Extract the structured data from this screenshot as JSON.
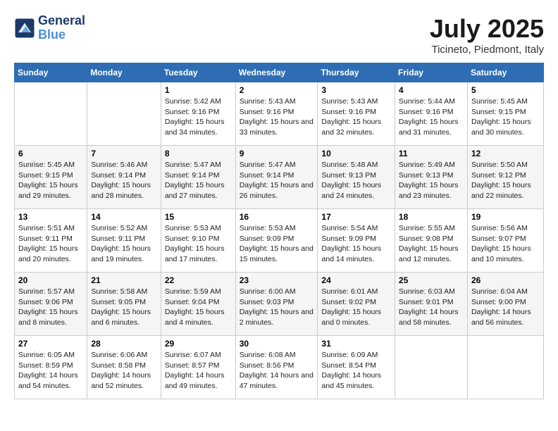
{
  "header": {
    "logo_line1": "General",
    "logo_line2": "Blue",
    "month": "July 2025",
    "location": "Ticineto, Piedmont, Italy"
  },
  "days_of_week": [
    "Sunday",
    "Monday",
    "Tuesday",
    "Wednesday",
    "Thursday",
    "Friday",
    "Saturday"
  ],
  "weeks": [
    [
      {
        "day": "",
        "info": ""
      },
      {
        "day": "",
        "info": ""
      },
      {
        "day": "1",
        "sunrise": "5:42 AM",
        "sunset": "9:16 PM",
        "daylight": "15 hours and 34 minutes."
      },
      {
        "day": "2",
        "sunrise": "5:43 AM",
        "sunset": "9:16 PM",
        "daylight": "15 hours and 33 minutes."
      },
      {
        "day": "3",
        "sunrise": "5:43 AM",
        "sunset": "9:16 PM",
        "daylight": "15 hours and 32 minutes."
      },
      {
        "day": "4",
        "sunrise": "5:44 AM",
        "sunset": "9:16 PM",
        "daylight": "15 hours and 31 minutes."
      },
      {
        "day": "5",
        "sunrise": "5:45 AM",
        "sunset": "9:15 PM",
        "daylight": "15 hours and 30 minutes."
      }
    ],
    [
      {
        "day": "6",
        "sunrise": "5:45 AM",
        "sunset": "9:15 PM",
        "daylight": "15 hours and 29 minutes."
      },
      {
        "day": "7",
        "sunrise": "5:46 AM",
        "sunset": "9:14 PM",
        "daylight": "15 hours and 28 minutes."
      },
      {
        "day": "8",
        "sunrise": "5:47 AM",
        "sunset": "9:14 PM",
        "daylight": "15 hours and 27 minutes."
      },
      {
        "day": "9",
        "sunrise": "5:47 AM",
        "sunset": "9:14 PM",
        "daylight": "15 hours and 26 minutes."
      },
      {
        "day": "10",
        "sunrise": "5:48 AM",
        "sunset": "9:13 PM",
        "daylight": "15 hours and 24 minutes."
      },
      {
        "day": "11",
        "sunrise": "5:49 AM",
        "sunset": "9:13 PM",
        "daylight": "15 hours and 23 minutes."
      },
      {
        "day": "12",
        "sunrise": "5:50 AM",
        "sunset": "9:12 PM",
        "daylight": "15 hours and 22 minutes."
      }
    ],
    [
      {
        "day": "13",
        "sunrise": "5:51 AM",
        "sunset": "9:11 PM",
        "daylight": "15 hours and 20 minutes."
      },
      {
        "day": "14",
        "sunrise": "5:52 AM",
        "sunset": "9:11 PM",
        "daylight": "15 hours and 19 minutes."
      },
      {
        "day": "15",
        "sunrise": "5:53 AM",
        "sunset": "9:10 PM",
        "daylight": "15 hours and 17 minutes."
      },
      {
        "day": "16",
        "sunrise": "5:53 AM",
        "sunset": "9:09 PM",
        "daylight": "15 hours and 15 minutes."
      },
      {
        "day": "17",
        "sunrise": "5:54 AM",
        "sunset": "9:09 PM",
        "daylight": "15 hours and 14 minutes."
      },
      {
        "day": "18",
        "sunrise": "5:55 AM",
        "sunset": "9:08 PM",
        "daylight": "15 hours and 12 minutes."
      },
      {
        "day": "19",
        "sunrise": "5:56 AM",
        "sunset": "9:07 PM",
        "daylight": "15 hours and 10 minutes."
      }
    ],
    [
      {
        "day": "20",
        "sunrise": "5:57 AM",
        "sunset": "9:06 PM",
        "daylight": "15 hours and 8 minutes."
      },
      {
        "day": "21",
        "sunrise": "5:58 AM",
        "sunset": "9:05 PM",
        "daylight": "15 hours and 6 minutes."
      },
      {
        "day": "22",
        "sunrise": "5:59 AM",
        "sunset": "9:04 PM",
        "daylight": "15 hours and 4 minutes."
      },
      {
        "day": "23",
        "sunrise": "6:00 AM",
        "sunset": "9:03 PM",
        "daylight": "15 hours and 2 minutes."
      },
      {
        "day": "24",
        "sunrise": "6:01 AM",
        "sunset": "9:02 PM",
        "daylight": "15 hours and 0 minutes."
      },
      {
        "day": "25",
        "sunrise": "6:03 AM",
        "sunset": "9:01 PM",
        "daylight": "14 hours and 58 minutes."
      },
      {
        "day": "26",
        "sunrise": "6:04 AM",
        "sunset": "9:00 PM",
        "daylight": "14 hours and 56 minutes."
      }
    ],
    [
      {
        "day": "27",
        "sunrise": "6:05 AM",
        "sunset": "8:59 PM",
        "daylight": "14 hours and 54 minutes."
      },
      {
        "day": "28",
        "sunrise": "6:06 AM",
        "sunset": "8:58 PM",
        "daylight": "14 hours and 52 minutes."
      },
      {
        "day": "29",
        "sunrise": "6:07 AM",
        "sunset": "8:57 PM",
        "daylight": "14 hours and 49 minutes."
      },
      {
        "day": "30",
        "sunrise": "6:08 AM",
        "sunset": "8:56 PM",
        "daylight": "14 hours and 47 minutes."
      },
      {
        "day": "31",
        "sunrise": "6:09 AM",
        "sunset": "8:54 PM",
        "daylight": "14 hours and 45 minutes."
      },
      {
        "day": "",
        "info": ""
      },
      {
        "day": "",
        "info": ""
      }
    ]
  ]
}
